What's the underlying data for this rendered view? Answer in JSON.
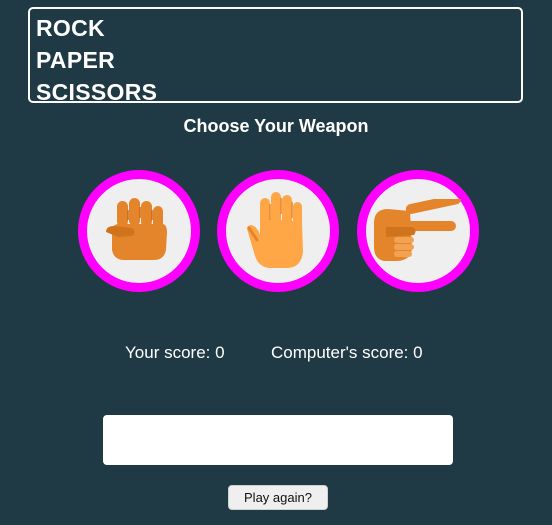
{
  "title": {
    "lines": [
      "ROCK",
      "PAPER",
      "SCISSORS"
    ]
  },
  "subtitle": "Choose Your Weapon",
  "weapons": [
    {
      "name": "rock",
      "icon": "rock-fist-icon"
    },
    {
      "name": "paper",
      "icon": "paper-hand-icon"
    },
    {
      "name": "scissors",
      "icon": "scissors-hand-icon"
    }
  ],
  "scores": {
    "player_label": "Your score:",
    "player_value": "0",
    "computer_label": "Computer's score:",
    "computer_value": "0"
  },
  "result": "",
  "play_again_label": "Play again?",
  "colors": {
    "background": "#203a45",
    "weapon_border": "#ff00ff",
    "weapon_fill": "#efefef",
    "rock_skin": "#e5852b",
    "paper_skin": "#ffa646",
    "scissors_skin": "#e5852b"
  }
}
